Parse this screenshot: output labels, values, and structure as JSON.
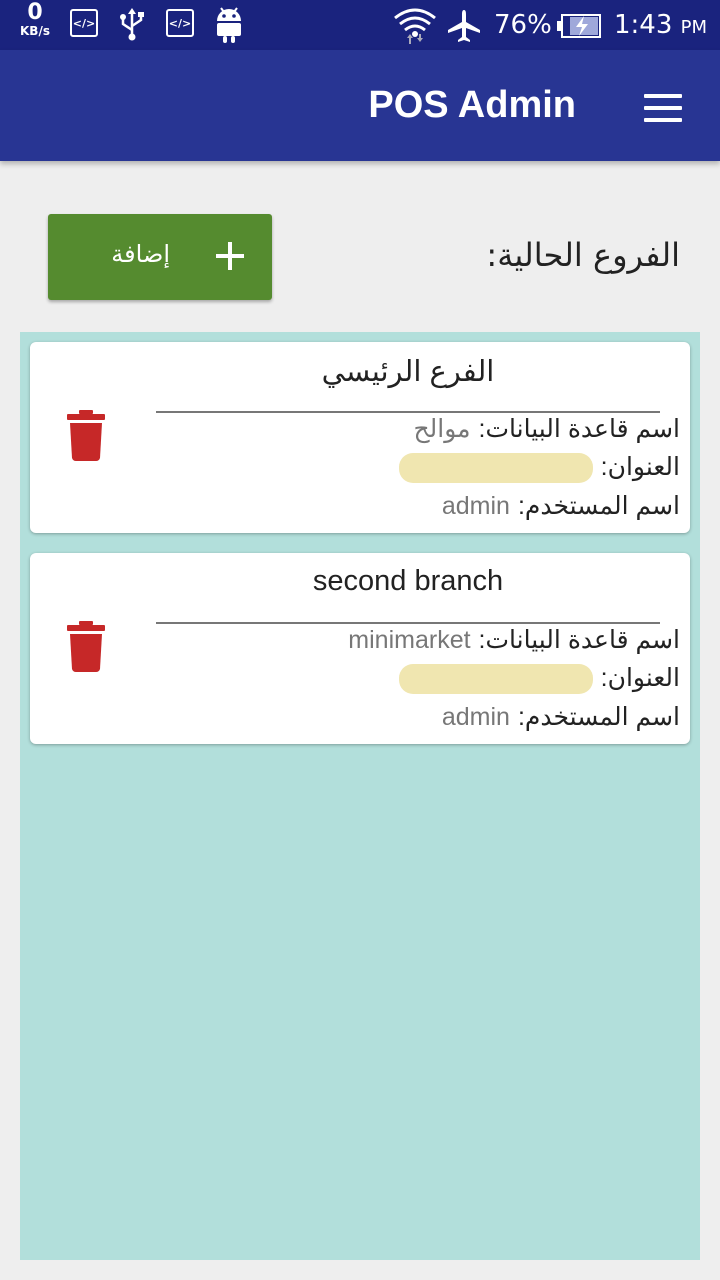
{
  "status_bar": {
    "kbs_value": "0",
    "kbs_unit": "KB/s",
    "code1": "</>",
    "code2": "</>",
    "battery_pct": "76%",
    "time": "1:43",
    "ampm": "PM",
    "icons": [
      "code-icon",
      "usb-icon",
      "code-icon",
      "android-icon",
      "wifi-icon",
      "airplane-icon",
      "battery-charging-icon"
    ]
  },
  "app_bar": {
    "title": "POS Admin"
  },
  "header": {
    "section_title": "الفروع الحالية:",
    "add_label": "إضافة"
  },
  "branches": [
    {
      "name": "الفرع الرئيسي",
      "db_label": "اسم قاعدة البيانات:",
      "db_value": "موالح",
      "address_label": "العنوان:",
      "user_label": "اسم المستخدم:",
      "user_value": "admin"
    },
    {
      "name": "second branch",
      "db_label": "اسم قاعدة البيانات:",
      "db_value": "minimarket",
      "address_label": "العنوان:",
      "user_label": "اسم المستخدم:",
      "user_value": "admin"
    }
  ],
  "colors": {
    "status_bar": "#1a237e",
    "app_bar": "#283593",
    "add_button": "#558b2f",
    "list_bg": "#b2dfdb",
    "delete_icon": "#c62828",
    "page_bg": "#eeeeee"
  }
}
